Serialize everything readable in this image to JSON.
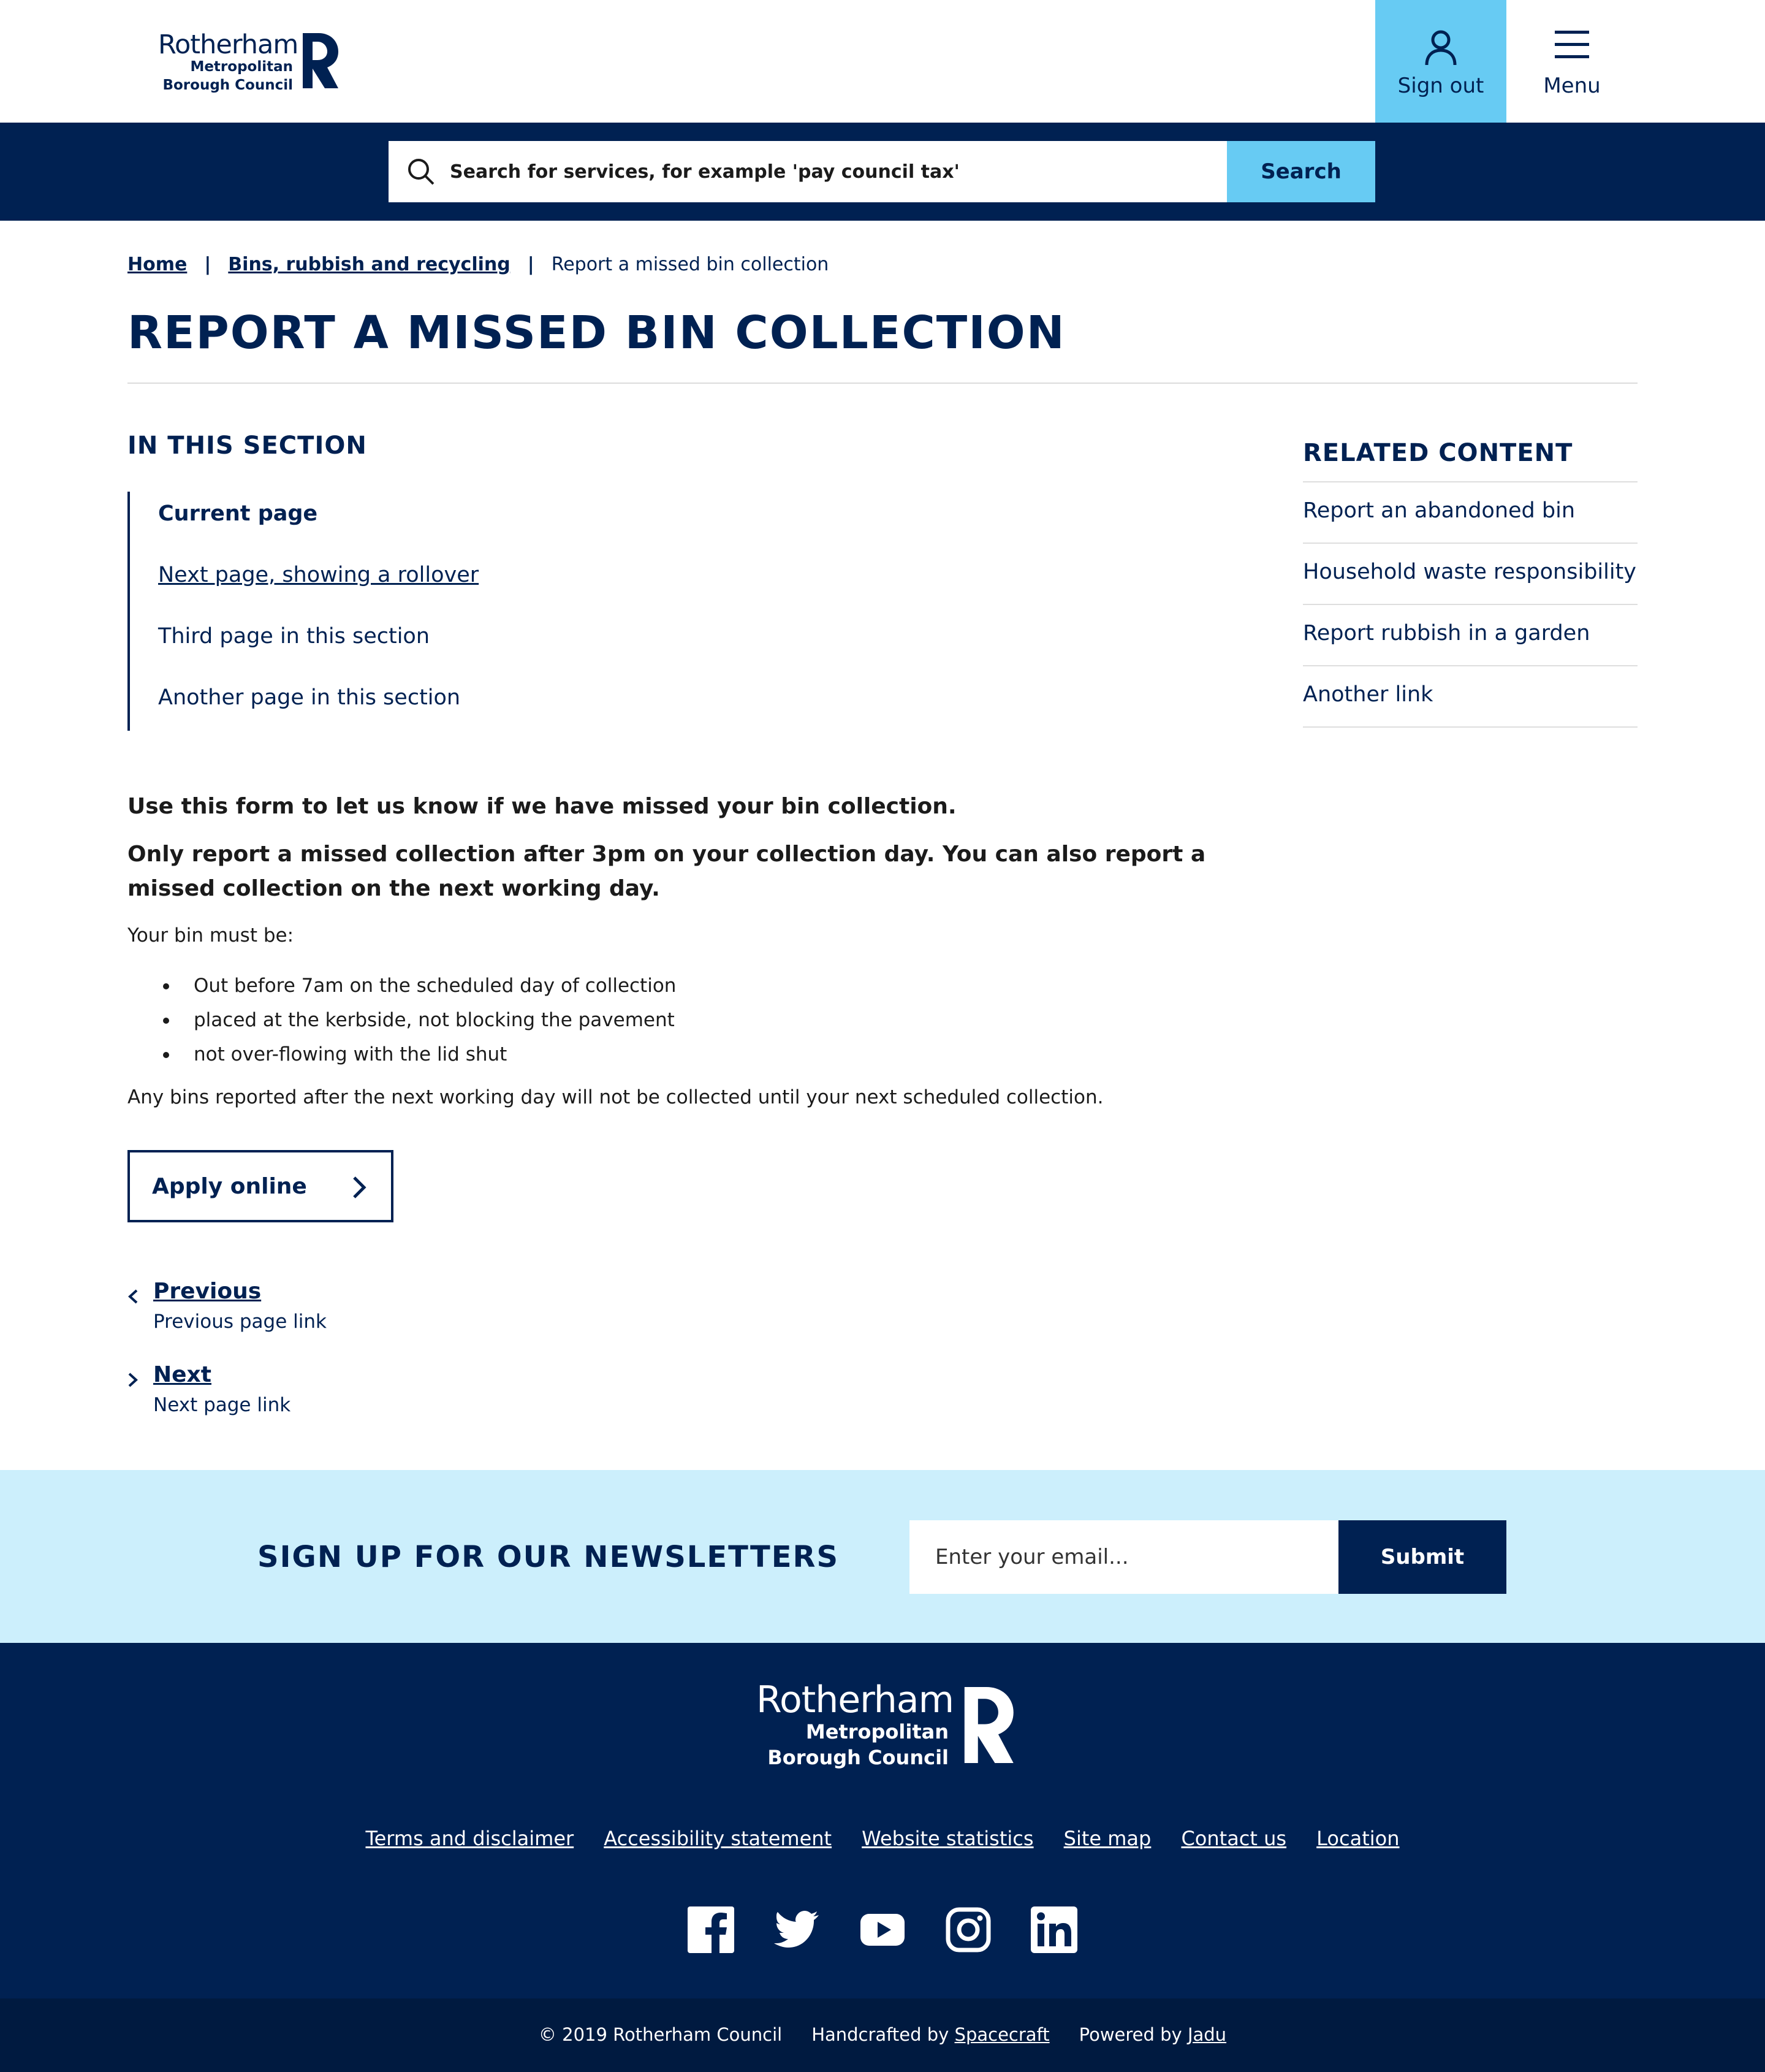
{
  "header": {
    "logo_line1": "Rotherham",
    "logo_line2": "Metropolitan\nBorough Council",
    "signout_label": "Sign out",
    "menu_label": "Menu"
  },
  "search": {
    "placeholder": "Search for services, for example 'pay council tax'",
    "button_label": "Search"
  },
  "breadcrumb": {
    "items": [
      "Home",
      "Bins, rubbish and recycling"
    ],
    "current": "Report a missed bin collection",
    "separator": "|"
  },
  "page_title": "REPORT A MISSED BIN COLLECTION",
  "in_this_section": {
    "heading": "IN THIS SECTION",
    "items": [
      "Current page",
      "Next page, showing a rollover",
      "Third page in this section",
      "Another page in this section"
    ]
  },
  "related_content": {
    "heading": "RELATED CONTENT",
    "items": [
      "Report an abandoned bin",
      "Household waste responsibility",
      "Report rubbish in a garden",
      "Another link"
    ]
  },
  "content": {
    "lead1": "Use this form to let us know if we have missed your bin collection.",
    "lead2": "Only report a missed collection after 3pm on your collection day. You can also report a missed collection on the next working day.",
    "intro": "Your bin must be:",
    "bullets": [
      "Out before 7am on the scheduled day of collection",
      "placed at the kerbside, not blocking the pavement",
      "not over-flowing with the lid shut"
    ],
    "note": "Any bins reported after the next working day will not be collected until your next scheduled collection.",
    "apply_label": "Apply online"
  },
  "pagination": {
    "previous_label": "Previous",
    "previous_sub": "Previous page link",
    "next_label": "Next",
    "next_sub": "Next page link"
  },
  "newsletter": {
    "heading": "SIGN UP FOR OUR NEWSLETTERS",
    "placeholder": "Enter your email...",
    "submit_label": "Submit"
  },
  "footer": {
    "logo_line1": "Rotherham",
    "logo_line2": "Metropolitan\nBorough Council",
    "links": [
      "Terms and disclaimer",
      "Accessibility statement",
      "Website statistics",
      "Site map",
      "Contact us",
      "Location"
    ],
    "social_icons": [
      "facebook-icon",
      "twitter-icon",
      "youtube-icon",
      "instagram-icon",
      "linkedin-icon"
    ],
    "copyright": "© 2019 Rotherham Council",
    "handcrafted_prefix": "Handcrafted by",
    "handcrafted_link": "Spacecraft",
    "powered_prefix": "Powered by",
    "powered_link": "Jadu"
  },
  "colors": {
    "navy": "#002152",
    "accent": "#67cbf3",
    "newsletter_bg": "#cceffc",
    "text": "#1b1b1b"
  }
}
